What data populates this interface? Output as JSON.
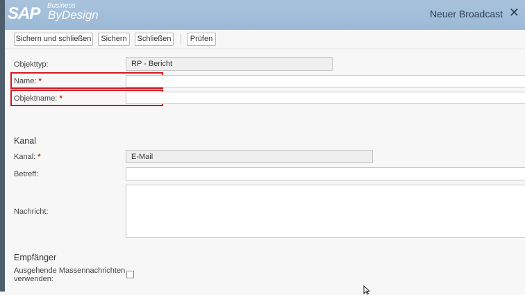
{
  "brand": {
    "sap": "SAP",
    "business": "Business",
    "bydesign": "ByDesign"
  },
  "window": {
    "title": "Neuer Broadcast",
    "close_icon": "close-icon"
  },
  "toolbar": {
    "save_close": "Sichern und schließen",
    "save": "Sichern",
    "close": "Schließen",
    "check": "Prüfen"
  },
  "form": {
    "object_type": {
      "label": "Objekttyp:",
      "value": "RP - Bericht"
    },
    "name": {
      "label": "Name:",
      "value": ""
    },
    "object_name": {
      "label": "Objektname:",
      "value": ""
    },
    "required_mark": "*"
  },
  "channel": {
    "heading": "Kanal",
    "channel_label": "Kanal:",
    "channel_value": "E-Mail",
    "subject_label": "Betreff:",
    "subject_value": "",
    "message_label": "Nachricht:",
    "message_value": ""
  },
  "recipients": {
    "heading": "Empfänger",
    "mass_label_line1": "Ausgehende Massennachrichten",
    "mass_label_line2": "verwenden:",
    "mass_checked": false
  },
  "colors": {
    "header": "#9bb9d6",
    "highlight": "#d2191f",
    "required": "#c0281e"
  }
}
